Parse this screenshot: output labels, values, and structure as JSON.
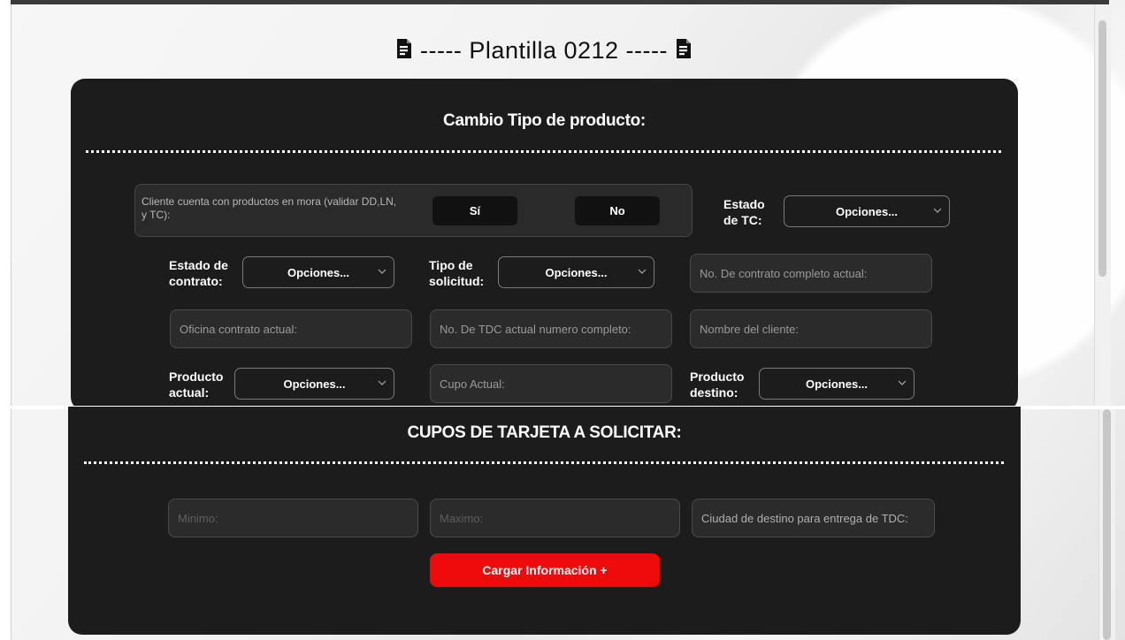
{
  "header": {
    "title": "----- Plantilla 0212 -----"
  },
  "section1": {
    "title": "Cambio Tipo de producto:",
    "mora": {
      "label": "Cliente cuenta con productos en mora (validar DD,LN, y TC):",
      "yes_label": "Sí",
      "no_label": "No"
    },
    "estado_tc": {
      "label": "Estado de TC:",
      "value": "Opciones..."
    },
    "estado_contrato": {
      "label": "Estado de contrato:",
      "value": "Opciones..."
    },
    "tipo_solicitud": {
      "label": "Tipo de solicitud:",
      "value": "Opciones..."
    },
    "contrato_completo_placeholder": "No. De contrato completo actual:",
    "oficina_placeholder": "Oficina contrato actual:",
    "tdc_actual_placeholder": "No. De TDC actual numero completo:",
    "nombre_cliente_placeholder": "Nombre del cliente:",
    "producto_actual": {
      "label": "Producto actual:",
      "value": "Opciones..."
    },
    "cupo_actual_placeholder": "Cupo Actual:",
    "producto_destino": {
      "label": "Producto destino:",
      "value": "Opciones..."
    }
  },
  "section2": {
    "title": "CUPOS DE TARJETA A SOLICITAR:",
    "minimo_placeholder": "Minimo:",
    "maximo_placeholder": "Maximo:",
    "ciudad_placeholder": "Ciudad de destino para entrega de TDC:",
    "submit_label": "Cargar Información +"
  },
  "colors": {
    "card_bg": "#1c1c1c",
    "accent_red": "#ee0a0a",
    "field_bg": "#2b2b2b"
  }
}
